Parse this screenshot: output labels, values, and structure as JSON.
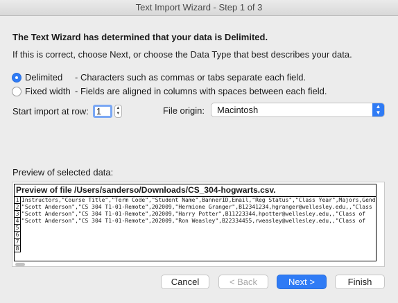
{
  "window": {
    "title": "Text Import Wizard - Step 1 of 3"
  },
  "heading": "The Text Wizard has determined that your data is Delimited.",
  "subtext": "If this is correct, choose Next, or choose the Data Type that best describes your data.",
  "data_type": {
    "selected": "Delimited",
    "options": [
      {
        "label": "Delimited",
        "desc": "- Characters such as commas or tabs separate each field."
      },
      {
        "label": "Fixed width",
        "desc": "- Fields are aligned in columns with spaces between each field."
      }
    ]
  },
  "start_row": {
    "label": "Start import at row:",
    "value": "1"
  },
  "file_origin": {
    "label": "File origin:",
    "value": "Macintosh"
  },
  "preview": {
    "label": "Preview of selected data:",
    "title": "Preview of file /Users/sanderso/Downloads/CS_304-hogwarts.csv.",
    "rows": [
      {
        "num": "1",
        "text": "Instructors,\"Course Title\",\"Term Code\",\"Student Name\",BannerID,Email,\"Reg Status\",\"Class Year\",Majors,Gender"
      },
      {
        "num": "2",
        "text": "\"Scott Anderson\",\"CS 304 T1-01-Remote\",202009,\"Hermione Granger\",B12341234,hgranger@wellesley.edu,,\"Class"
      },
      {
        "num": "3",
        "text": "\"Scott Anderson\",\"CS 304 T1-01-Remote\",202009,\"Harry Potter\",B11223344,hpotter@wellesley.edu,,\"Class of"
      },
      {
        "num": "4",
        "text": "\"Scott Anderson\",\"CS 304 T1-01-Remote\",202009,\"Ron Weasley\",B22334455,rweasley@wellesley.edu,,\"Class of"
      },
      {
        "num": "5",
        "text": ""
      },
      {
        "num": "6",
        "text": ""
      },
      {
        "num": "7",
        "text": ""
      },
      {
        "num": "8",
        "text": ""
      }
    ]
  },
  "buttons": {
    "cancel": "Cancel",
    "back": "< Back",
    "next": "Next >",
    "finish": "Finish"
  },
  "colors": {
    "accent": "#2f7bf5",
    "window_bg": "#ececec"
  }
}
